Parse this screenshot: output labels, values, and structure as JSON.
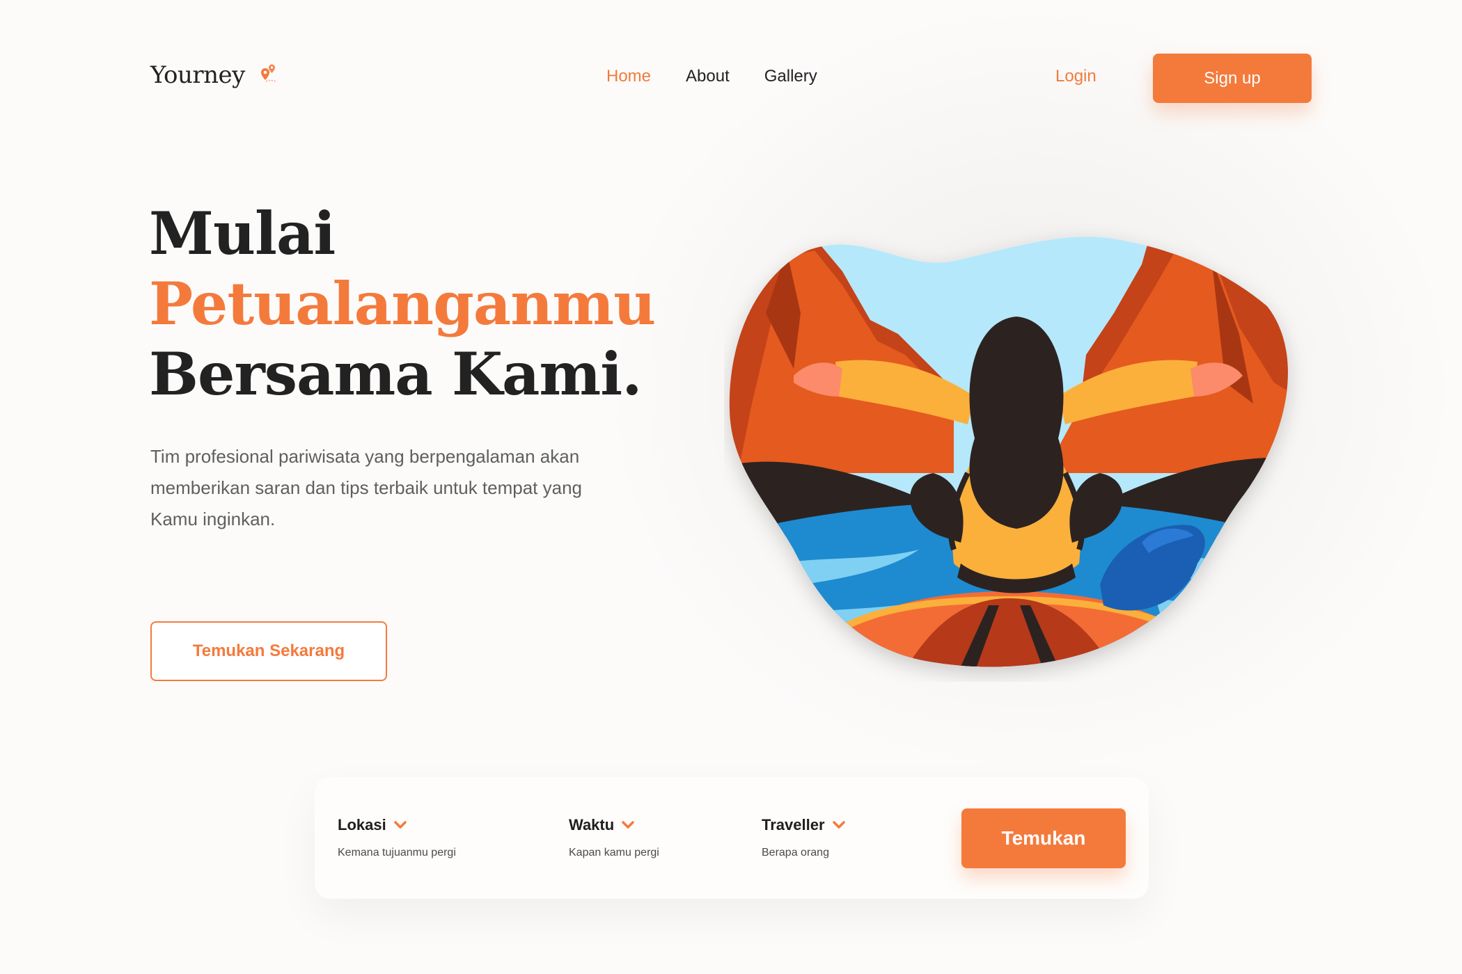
{
  "brand": {
    "name": "Yourney",
    "icon": "map-pin-icon",
    "accent": "#f47a3c"
  },
  "nav": {
    "items": [
      {
        "label": "Home",
        "active": true
      },
      {
        "label": "About",
        "active": false
      },
      {
        "label": "Gallery",
        "active": false
      }
    ],
    "login_label": "Login",
    "signup_label": "Sign up"
  },
  "hero": {
    "title_line1": "Mulai",
    "title_line2": "Petualanganmu",
    "title_line3": "Bersama Kami.",
    "description": "Tim profesional pariwisata yang berpengalaman akan memberikan saran dan tips terbaik untuk tempat yang Kamu inginkan.",
    "cta_label": "Temukan Sekarang"
  },
  "search": {
    "fields": [
      {
        "label": "Lokasi",
        "hint": "Kemana tujuanmu pergi"
      },
      {
        "label": "Waktu",
        "hint": "Kapan kamu pergi"
      },
      {
        "label": "Traveller",
        "hint": "Berapa orang"
      }
    ],
    "button_label": "Temukan"
  },
  "colors": {
    "accent": "#f47a3c",
    "text_dark": "#222222",
    "text_muted": "#5f5f5f"
  }
}
